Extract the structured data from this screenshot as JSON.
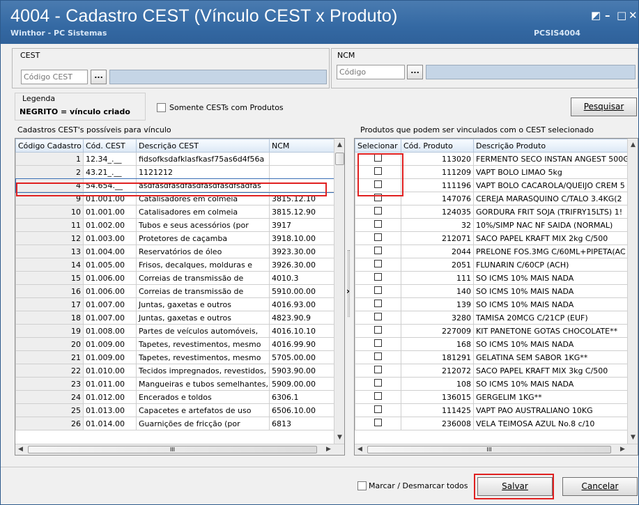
{
  "window": {
    "title": "4004 - Cadastro CEST (Vínculo CEST x Produto)",
    "subtitle": "Winthor - PC Sistemas",
    "code": "PCSIS4004",
    "restore_glyph": "◩",
    "minimize_glyph": "–",
    "maximize_glyph": "□",
    "close_glyph": "✕"
  },
  "cest": {
    "group_label": "CEST",
    "input_placeholder": "Código CEST",
    "lookup_label": "..."
  },
  "ncm": {
    "group_label": "NCM",
    "input_placeholder": "Código",
    "lookup_label": "..."
  },
  "legend": {
    "title": "Legenda",
    "text": "NEGRITO = vínculo criado"
  },
  "filter": {
    "only_with_products_label": "Somente CESTs com Produtos",
    "search_button": "Pesquisar"
  },
  "cest_grid": {
    "group_label": "Cadastros CEST's possíveis para vínculo",
    "columns": [
      "Código Cadastro",
      "Cód. CEST",
      "Descrição CEST",
      "NCM"
    ],
    "rows": [
      [
        "1",
        "12.34_.__",
        "fidsofksdafklasfkasf75as6d4f56a",
        ""
      ],
      [
        "2",
        "43.21_.__",
        "1121212",
        ""
      ],
      [
        "4",
        "54.654.__",
        "asdfasdfasdfasdfasdfasdfsadfas",
        ""
      ],
      [
        "9",
        "01.001.00",
        "Catalisadores em colmeia",
        "3815.12.10"
      ],
      [
        "10",
        "01.001.00",
        "Catalisadores em colmeia",
        "3815.12.90"
      ],
      [
        "11",
        "01.002.00",
        "Tubos e seus acessórios (por",
        "3917"
      ],
      [
        "12",
        "01.003.00",
        "Protetores de caçamba",
        "3918.10.00"
      ],
      [
        "13",
        "01.004.00",
        "Reservatórios de óleo",
        "3923.30.00"
      ],
      [
        "14",
        "01.005.00",
        "Frisos, decalques, molduras e",
        "3926.30.00"
      ],
      [
        "15",
        "01.006.00",
        "Correias de transmissão de",
        "4010.3"
      ],
      [
        "16",
        "01.006.00",
        "Correias de transmissão de",
        "5910.00.00"
      ],
      [
        "17",
        "01.007.00",
        "Juntas, gaxetas e outros",
        "4016.93.00"
      ],
      [
        "18",
        "01.007.00",
        "Juntas, gaxetas e outros",
        "4823.90.9"
      ],
      [
        "19",
        "01.008.00",
        "Partes de veículos automóveis,",
        "4016.10.10"
      ],
      [
        "20",
        "01.009.00",
        "Tapetes, revestimentos, mesmo",
        "4016.99.90"
      ],
      [
        "21",
        "01.009.00",
        "Tapetes, revestimentos, mesmo",
        "5705.00.00"
      ],
      [
        "22",
        "01.010.00",
        "Tecidos impregnados, revestidos,",
        "5903.90.00"
      ],
      [
        "23",
        "01.011.00",
        "Mangueiras e tubos semelhantes,",
        "5909.00.00"
      ],
      [
        "24",
        "01.012.00",
        "Encerados e toldos",
        "6306.1"
      ],
      [
        "25",
        "01.013.00",
        "Capacetes e artefatos de uso",
        "6506.10.00"
      ],
      [
        "26",
        "01.014.00",
        "Guarnições de fricção (por",
        "6813"
      ]
    ]
  },
  "product_grid": {
    "group_label": "Produtos que podem ser vinculados com o CEST  selecionado",
    "columns": [
      "Selecionar",
      "Cód. Produto",
      "Descrição Produto"
    ],
    "rows": [
      [
        "113020",
        "FERMENTO SECO INSTAN ANGEST 500G"
      ],
      [
        "111209",
        "VAPT BOLO LIMAO 5kg"
      ],
      [
        "111196",
        "VAPT BOLO CACAROLA/QUEIJO CREM 5"
      ],
      [
        "147076",
        "CEREJA MARASQUINO C/TALO 3.4KG(2"
      ],
      [
        "124035",
        "GORDURA FRIT SOJA (TRIFRY15LTS) 1!"
      ],
      [
        "32",
        "10%/SIMP NAC NF SAIDA (NORMAL)"
      ],
      [
        "212071",
        "SACO PAPEL KRAFT MIX 2kg C/500"
      ],
      [
        "2044",
        "PRELONE FOS.3MG  C/60ML+PIPETA(AC"
      ],
      [
        "2051",
        "FLUNARIN C/60CP (ACH)"
      ],
      [
        "111",
        "SO ICMS 10% MAIS NADA"
      ],
      [
        "140",
        "SO ICMS 10% MAIS NADA"
      ],
      [
        "139",
        "SO ICMS 10% MAIS NADA"
      ],
      [
        "3280",
        "TAMISA 20MCG C/21CP     (EUF)"
      ],
      [
        "227009",
        "KIT PANETONE GOTAS CHOCOLATE**"
      ],
      [
        "168",
        "SO ICMS 10% MAIS NADA"
      ],
      [
        "181291",
        "GELATINA SEM SABOR 1KG**"
      ],
      [
        "212072",
        "SACO PAPEL KRAFT MIX 3kg C/500"
      ],
      [
        "108",
        "SO ICMS 10% MAIS NADA"
      ],
      [
        "136015",
        "GERGELIM 1KG**"
      ],
      [
        "111425",
        "VAPT PAO AUSTRALIANO 10KG"
      ],
      [
        "236008",
        "VELA TEIMOSA AZUL No.8 c/10"
      ]
    ]
  },
  "footer": {
    "mark_all_label": "Marcar / Desmarcar todos",
    "save_button": "Salvar",
    "cancel_button": "Cancelar"
  },
  "scroll_glyphs": {
    "up": "▲",
    "down": "▼",
    "left": "◀",
    "right": "▶",
    "grip": "III",
    "split": "›"
  },
  "colors": {
    "titlebar": "#3469a3",
    "selected_row_border": "#3a6fb5",
    "highlight": "#e02020",
    "readonly_field": "#c5d5e6"
  }
}
